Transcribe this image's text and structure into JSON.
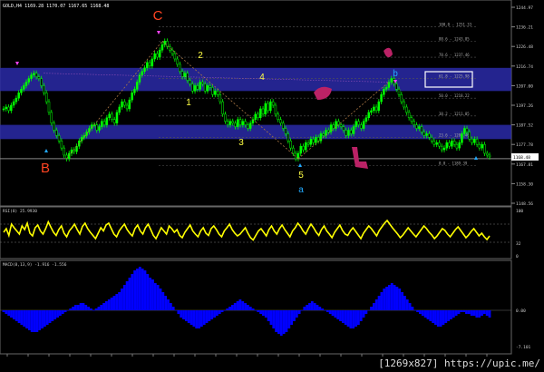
{
  "header_text": "GOLD,H4  1169.28  1170.07  1167.65  1168.48",
  "watermark": "[1269x827] https://upic.me/",
  "colors": {
    "background": "#000000",
    "candle": "#00ff00",
    "rsi_line": "#ffff00",
    "macd_bar": "#0000ff",
    "zone_fill": "#2a2aa8",
    "label_orange": "#ff4422",
    "label_yellow": "#ffff44",
    "label_cyan": "#22aaff",
    "highlight": "#bb2266"
  },
  "chart_data": [
    {
      "type": "candlestick",
      "symbol": "GOLD",
      "timeframe": "H4",
      "ohlc_last": {
        "open": 1169.28,
        "high": 1170.07,
        "low": 1167.65,
        "close": 1168.48
      },
      "y_ticks": [
        1244.97,
        1236.21,
        1226.48,
        1216.74,
        1207.0,
        1197.26,
        1187.52,
        1177.78,
        1167.81,
        1158.3,
        1148.56
      ],
      "last_price_label": "1168.48",
      "close_series": [
        1195,
        1196,
        1194,
        1197,
        1199,
        1201,
        1204,
        1206,
        1208,
        1210,
        1212,
        1214,
        1215,
        1213,
        1212,
        1208,
        1204,
        1199,
        1193,
        1187,
        1183,
        1180,
        1177,
        1173,
        1169,
        1167,
        1170,
        1172,
        1171,
        1174,
        1177,
        1179,
        1180,
        1182,
        1184,
        1186,
        1186,
        1183,
        1185,
        1188,
        1186,
        1190,
        1192,
        1189,
        1187,
        1193,
        1196,
        1199,
        1197,
        1195,
        1200,
        1204,
        1206,
        1210,
        1214,
        1216,
        1218,
        1221,
        1219,
        1223,
        1226,
        1224,
        1228,
        1231,
        1233,
        1230,
        1228,
        1226,
        1223,
        1220,
        1216,
        1213,
        1215,
        1211,
        1209,
        1205,
        1208,
        1206,
        1210,
        1209,
        1205,
        1208,
        1207,
        1203,
        1205,
        1203,
        1199,
        1192,
        1188,
        1186,
        1188,
        1187,
        1185,
        1189,
        1186,
        1188,
        1186,
        1184,
        1187,
        1189,
        1192,
        1190,
        1195,
        1192,
        1198,
        1194,
        1199,
        1197,
        1192,
        1189,
        1187,
        1184,
        1181,
        1177,
        1173,
        1170,
        1167,
        1170,
        1174,
        1172,
        1176,
        1175,
        1178,
        1176,
        1179,
        1177,
        1181,
        1180,
        1183,
        1182,
        1186,
        1184,
        1188,
        1186,
        1185,
        1183,
        1180,
        1183,
        1181,
        1185,
        1188,
        1186,
        1184,
        1188,
        1190,
        1193,
        1194,
        1196,
        1194,
        1199,
        1203,
        1206,
        1207,
        1210,
        1212,
        1209,
        1206,
        1203,
        1199,
        1196,
        1193,
        1190,
        1188,
        1186,
        1184,
        1185,
        1182,
        1180,
        1181,
        1179,
        1177,
        1175,
        1176,
        1174,
        1172,
        1173,
        1176,
        1174,
        1177,
        1175,
        1173,
        1176,
        1181,
        1184,
        1182,
        1178,
        1176,
        1178,
        1175,
        1173,
        1175,
        1170,
        1169,
        1168
      ],
      "fibonacci_levels": [
        {
          "label": "100.0 - 1251.33",
          "price": 1241
        },
        {
          "label": "88.6 - 1243.85",
          "price": 1233
        },
        {
          "label": "78.6 - 1237.46",
          "price": 1224
        },
        {
          "label": "61.8 - 1225.98",
          "price": 1212
        },
        {
          "label": "50.0 - 1218.22",
          "price": 1201
        },
        {
          "label": "38.2 - 1211.05",
          "price": 1191
        },
        {
          "label": "23.6 - 1203.46",
          "price": 1179
        },
        {
          "label": "0.0 - 1189.39",
          "price": 1163
        }
      ],
      "zones": [
        {
          "from": 1205,
          "to": 1218
        },
        {
          "from": 1178,
          "to": 1186
        }
      ],
      "support_level": 1167,
      "wave_labels": [
        "C",
        "B",
        "2",
        "1",
        "4",
        "3",
        "5",
        "a",
        "b"
      ]
    },
    {
      "type": "line",
      "name": "RSI(8) 25.9930",
      "levels": [
        70,
        30
      ],
      "y_ticks": [
        "100",
        "32",
        "0"
      ],
      "values": [
        52,
        60,
        45,
        70,
        62,
        55,
        48,
        66,
        58,
        72,
        50,
        44,
        62,
        68,
        55,
        48,
        60,
        75,
        63,
        52,
        45,
        58,
        66,
        50,
        42,
        55,
        62,
        70,
        58,
        48,
        65,
        72,
        60,
        52,
        45,
        38,
        50,
        62,
        55,
        68,
        72,
        60,
        48,
        42,
        55,
        63,
        70,
        58,
        50,
        44,
        60,
        68,
        55,
        48,
        62,
        70,
        58,
        45,
        38,
        50,
        62,
        55,
        48,
        66,
        60,
        52,
        58,
        45,
        40,
        52,
        60,
        68,
        55,
        48,
        42,
        55,
        62,
        50,
        45,
        60,
        66,
        58,
        48,
        42,
        55,
        62,
        70,
        58,
        50,
        44,
        48,
        55,
        62,
        50,
        40,
        35,
        45,
        55,
        60,
        52,
        44,
        58,
        66,
        55,
        48,
        60,
        68,
        58,
        50,
        42,
        55,
        62,
        72,
        65,
        55,
        48,
        60,
        70,
        62,
        52,
        45,
        58,
        66,
        55,
        48,
        40,
        52,
        60,
        68,
        56,
        48,
        45,
        55,
        62,
        54,
        46,
        38,
        50,
        58,
        66,
        60,
        52,
        44,
        56,
        64,
        72,
        78,
        70,
        62,
        55,
        48,
        40,
        46,
        54,
        62,
        55,
        48,
        42,
        50,
        58,
        66,
        60,
        52,
        46,
        38,
        44,
        52,
        60,
        56,
        48,
        42,
        50,
        58,
        64,
        56,
        48,
        40,
        46,
        54,
        60,
        52,
        44,
        50,
        42,
        36,
        44
      ]
    },
    {
      "type": "bar",
      "name": "MACD(8,13,9) -1.916 -1.556",
      "y_ticks": [
        "0.00",
        "-7.101"
      ],
      "values": [
        -1,
        -2,
        -3,
        -4,
        -5,
        -6,
        -7,
        -8,
        -9,
        -10,
        -11,
        -12,
        -12,
        -12,
        -11,
        -10,
        -9,
        -8,
        -7,
        -6,
        -5,
        -4,
        -3,
        -2,
        -1,
        0,
        1,
        2,
        3,
        3,
        4,
        4,
        3,
        2,
        1,
        0,
        1,
        2,
        3,
        4,
        5,
        6,
        7,
        8,
        9,
        10,
        12,
        14,
        16,
        18,
        20,
        22,
        23,
        24,
        23,
        22,
        20,
        18,
        17,
        15,
        14,
        12,
        10,
        8,
        6,
        4,
        2,
        0,
        -2,
        -4,
        -5,
        -6,
        -7,
        -8,
        -9,
        -10,
        -10,
        -9,
        -8,
        -7,
        -6,
        -5,
        -4,
        -3,
        -2,
        -1,
        0,
        1,
        2,
        3,
        4,
        5,
        6,
        5,
        4,
        3,
        2,
        1,
        0,
        -1,
        -2,
        -3,
        -4,
        -6,
        -8,
        -10,
        -12,
        -13,
        -14,
        -13,
        -12,
        -10,
        -8,
        -6,
        -4,
        -2,
        0,
        2,
        3,
        4,
        5,
        4,
        3,
        2,
        1,
        0,
        -1,
        -2,
        -3,
        -4,
        -5,
        -6,
        -7,
        -8,
        -9,
        -10,
        -10,
        -9,
        -8,
        -6,
        -4,
        -2,
        0,
        2,
        4,
        6,
        8,
        10,
        12,
        13,
        14,
        15,
        14,
        13,
        12,
        10,
        8,
        6,
        4,
        2,
        0,
        -1,
        -2,
        -3,
        -4,
        -5,
        -6,
        -7,
        -8,
        -9,
        -9,
        -8,
        -7,
        -6,
        -5,
        -4,
        -3,
        -2,
        -1,
        -1,
        -2,
        -2,
        -3,
        -3,
        -4,
        -4,
        -3,
        -2,
        -3,
        -4
      ]
    }
  ]
}
